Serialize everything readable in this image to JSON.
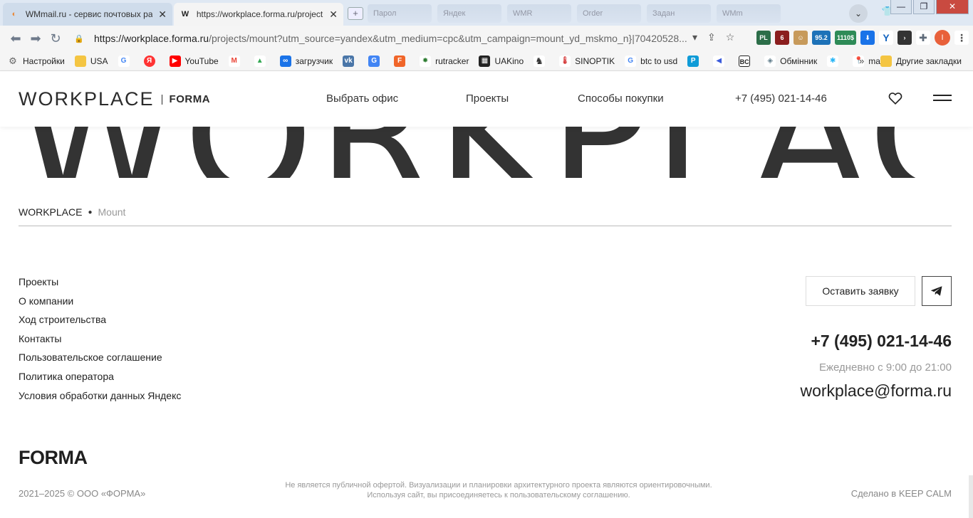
{
  "browser": {
    "tabs": [
      {
        "title": "WMmail.ru - сервис почтовых ра"
      },
      {
        "title": "https://workplace.forma.ru/project"
      }
    ],
    "ghost_tabs": [
      "Парол",
      "Яндек",
      "WMR",
      "Order",
      "Задан",
      "WMm"
    ],
    "url_host": "https://workplace.forma.ru",
    "url_rest": "/projects/mount?utm_source=yandex&utm_medium=cpc&utm_campaign=mount_yd_mskmo_n}|70420528...",
    "extension_badges": [
      "PL",
      "6",
      "95.2",
      "1110$"
    ],
    "profile_letter": "I",
    "bookmarks": [
      {
        "label": "Настройки",
        "icon": "gear-icon",
        "color": "#666666"
      },
      {
        "label": "USA",
        "icon": "folder-icon",
        "color": "#f4c542"
      },
      {
        "label": "",
        "icon": "google-icon",
        "color": "#4285f4"
      },
      {
        "label": "",
        "icon": "yandex-icon",
        "color": "#ff3333"
      },
      {
        "label": "YouTube",
        "icon": "youtube-icon",
        "color": "#ff0000"
      },
      {
        "label": "",
        "icon": "gmail-icon",
        "color": "#ea4335"
      },
      {
        "label": "",
        "icon": "drive-icon",
        "color": "#34a853"
      },
      {
        "label": "загрузчик",
        "icon": "loader-icon",
        "color": "#1a73e8"
      },
      {
        "label": "",
        "icon": "vk-icon",
        "color": "#4a76a8"
      },
      {
        "label": "",
        "icon": "translate-icon",
        "color": "#4285f4"
      },
      {
        "label": "",
        "icon": "f-icon",
        "color": "#f06529"
      },
      {
        "label": "rutracker",
        "icon": "rutracker-icon",
        "color": "#2e7d32"
      },
      {
        "label": "UAKino",
        "icon": "uakino-icon",
        "color": "#222222"
      },
      {
        "label": "",
        "icon": "chess-icon",
        "color": "#444444"
      },
      {
        "label": "SINOPTIK",
        "icon": "thermometer-icon",
        "color": "#d32f2f"
      },
      {
        "label": "btc to usd",
        "icon": "google-icon",
        "color": "#4285f4"
      },
      {
        "label": "",
        "icon": "p-icon",
        "color": "#0f9bd7"
      },
      {
        "label": "",
        "icon": "arrow-icon",
        "color": "#3b5bdb"
      },
      {
        "label": "",
        "icon": "bc-icon",
        "color": "#333333"
      },
      {
        "label": "Обмінник",
        "icon": "diamond-icon",
        "color": "#607d8b"
      },
      {
        "label": "",
        "icon": "star-icon",
        "color": "#29b6f6"
      },
      {
        "label": "maps",
        "icon": "maps-icon",
        "color": "#34a853"
      }
    ],
    "bookmarks_more": "»",
    "other_bookmarks": "Другие закладки"
  },
  "header": {
    "logo_word": "WORKPLACE",
    "logo_forma": "FORMA",
    "nav": [
      "Выбрать офис",
      "Проекты",
      "Способы покупки",
      "+7 (495) 021-14-46"
    ]
  },
  "hero": {
    "big_word": "WORKPLACE"
  },
  "breadcrumb": {
    "home": "WORKPLACE",
    "current": "Mount"
  },
  "footer": {
    "links": [
      "Проекты",
      "О компании",
      "Ход строительства",
      "Контакты",
      "Пользовательское соглашение",
      "Политика оператора",
      "Условия обработки данных Яндекс"
    ],
    "request_button": "Оставить заявку",
    "phone": "+7 (495) 021-14-46",
    "hours": "Ежедневно с 9:00 до 21:00",
    "email": "workplace@forma.ru",
    "forma_logo": "FORMA",
    "copyright": "2021–2025 © ООО «ФОРМА»",
    "disclaimer_line1": "Не является публичной офертой. Визуализации и планировки архитектурного проекта являются ориентировочными.",
    "disclaimer_line2": "Используя сайт, вы присоединяетесь к пользовательскому соглашению.",
    "made_by": "Сделано в KEEP CALM"
  }
}
